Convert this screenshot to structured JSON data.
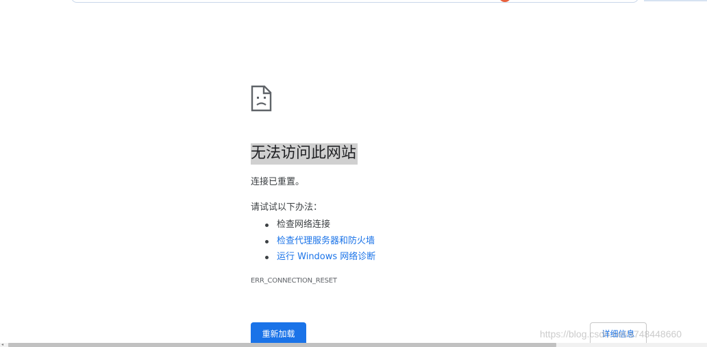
{
  "error_page": {
    "title": "无法访问此网站",
    "description": "连接已重置。",
    "suggestions_heading": "请试试以下办法：",
    "suggestions": [
      {
        "label": "检查网络连接",
        "link": false
      },
      {
        "label": "检查代理服务器和防火墙",
        "link": true
      },
      {
        "label": "运行 Windows 网络诊断",
        "link": true
      }
    ],
    "error_code": "ERR_CONNECTION_RESET",
    "reload_label": "重新加载",
    "details_label": "详细信息"
  },
  "watermark": "https://blog.csdn.net/a748448660",
  "icons": {
    "error_icon": "sad-page-icon",
    "bullet_icon": "bullet-icon"
  },
  "colors": {
    "accent": "#1a73e8",
    "text": "#202124",
    "secondary_text": "#3c4043",
    "heading_highlight": "#d0d0d0"
  }
}
